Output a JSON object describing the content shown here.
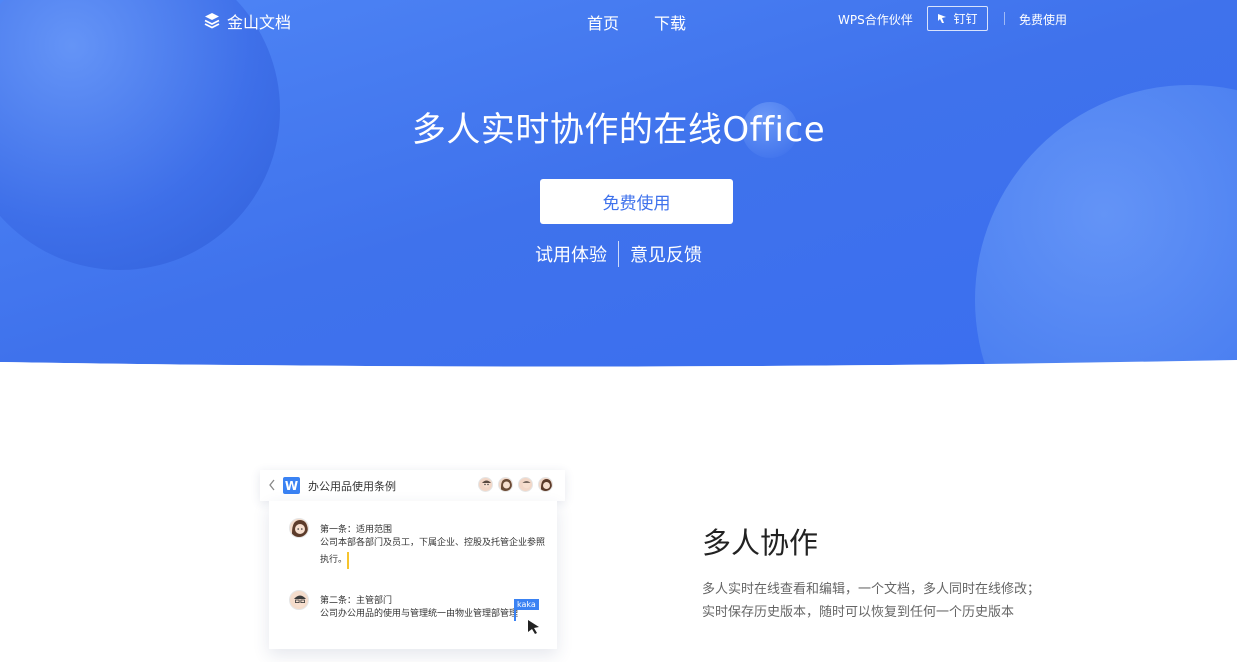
{
  "nav": {
    "logo": "金山文档",
    "home": "首页",
    "download": "下载",
    "partner": "WPS合作伙伴",
    "dingtalk": "钉钉",
    "free": "免费使用"
  },
  "hero": {
    "headline": "多人实时协作的在线Office",
    "cta": "免费使用",
    "trial": "试用体验",
    "feedback": "意见反馈",
    "colors": {
      "blue": "#3f72ec",
      "light_blue": "#5a8bf5"
    }
  },
  "doc": {
    "title": "办公用品使用条例",
    "para1_title": "第一条：适用范围",
    "para1_text": "公司本部各部门及员工，下属企业、控股及托管企业参照执行。",
    "para2_title": "第二条：主管部门",
    "para2_text": "公司办公用品的使用与管理统一由物业管理部管理",
    "cursor_user": "kaka"
  },
  "feature": {
    "title": "多人协作",
    "line1": "多人实时在线查看和编辑，一个文档，多人同时在线修改；",
    "line2": "实时保存历史版本，随时可以恢复到任何一个历史版本"
  }
}
